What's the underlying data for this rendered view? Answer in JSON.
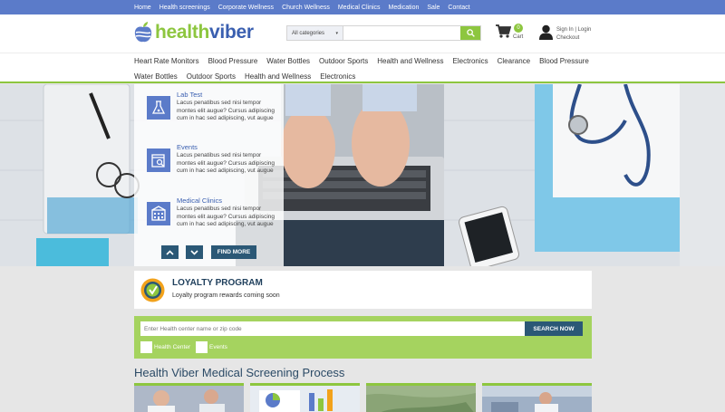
{
  "top_nav": [
    "Home",
    "Health screenings",
    "Corporate Wellness",
    "Church Wellness",
    "Medical Clinics",
    "Medication",
    "Sale",
    "Contact"
  ],
  "logo": {
    "part1": "health",
    "part2": "viber"
  },
  "search": {
    "category": "All categories",
    "placeholder": ""
  },
  "cart": {
    "count": "0",
    "label": "Cart"
  },
  "account": {
    "sign_in": "Sign In",
    "sep": "|",
    "login": "Login",
    "checkout": "Checkout"
  },
  "categories_row1": [
    "Heart Rate Monitors",
    "Blood Pressure",
    "Water Bottles",
    "Outdoor Sports",
    "Health and Wellness",
    "Electronics",
    "Clearance",
    "Blood Pressure"
  ],
  "categories_row2": [
    "Water Bottles",
    "Outdoor Sports",
    "Health and Wellness",
    "Electronics"
  ],
  "services": [
    {
      "title": "Lab Test",
      "desc": "Lacus penatibus sed nisi tempor montes elit augue? Cursus adipiscing cum in hac sed adipiscing, vut augue",
      "icon": "lab-flask-icon"
    },
    {
      "title": "Events",
      "desc": "Lacus penatibus sed nisi tempor montes elit augue? Cursus adipiscing cum in hac sed adipiscing, vut augue",
      "icon": "calendar-search-icon"
    },
    {
      "title": "Medical Clinics",
      "desc": "Lacus penatibus sed nisi tempor montes elit augue? Cursus adipiscing cum in hac sed adipiscing, vut augue",
      "icon": "clinic-building-icon"
    }
  ],
  "hero": {
    "find_more": "FIND MORE"
  },
  "loyalty": {
    "title": "LOYALTY PROGRAM",
    "subtitle": "Loyalty program rewards coming soon"
  },
  "health_search": {
    "placeholder": "Enter Health center name or zip code",
    "button": "SEARCH NOW",
    "options": [
      "Health Center",
      "Events"
    ]
  },
  "process": {
    "title": "Health Viber Medical Screening Process"
  },
  "colors": {
    "brand_blue": "#5b7bc9",
    "brand_green": "#8dc63f",
    "dark_teal": "#2b5876"
  }
}
